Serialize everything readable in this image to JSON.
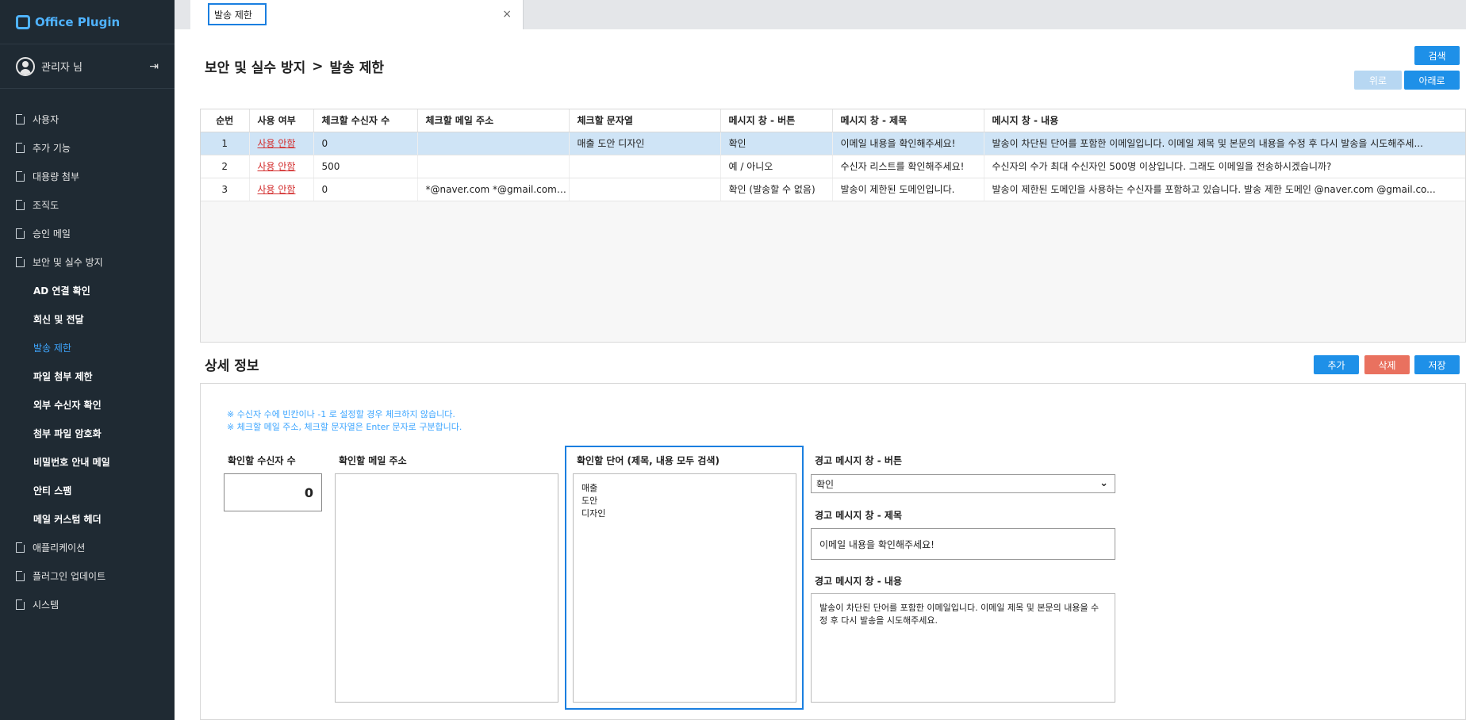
{
  "app": {
    "brand": "Office Plugin"
  },
  "user": {
    "name": "관리자 님"
  },
  "sidebar": {
    "items": [
      {
        "label": "사용자"
      },
      {
        "label": "추가 기능"
      },
      {
        "label": "대용량 첨부"
      },
      {
        "label": "조직도"
      },
      {
        "label": "승인 메일"
      },
      {
        "label": "보안 및 실수 방지"
      },
      {
        "label": "AD 연결 확인"
      },
      {
        "label": "회신 및 전달"
      },
      {
        "label": "발송 제한"
      },
      {
        "label": "파일 첨부 제한"
      },
      {
        "label": "외부 수신자 확인"
      },
      {
        "label": "첨부 파일 암호화"
      },
      {
        "label": "비밀번호 안내 메일"
      },
      {
        "label": "안티 스팸"
      },
      {
        "label": "메일 커스텀 헤더"
      },
      {
        "label": "애플리케이션"
      },
      {
        "label": "플러그인 업데이트"
      },
      {
        "label": "시스템"
      }
    ]
  },
  "tab": {
    "label": "발송 제한",
    "close": "×"
  },
  "breadcrumb": {
    "parent": "보안 및 실수 방지",
    "sep": ">",
    "current": "발송 제한"
  },
  "buttons": {
    "search": "검색",
    "up": "위로",
    "down": "아래로",
    "add": "추가",
    "delete": "삭제",
    "save": "저장"
  },
  "table": {
    "headers": [
      "순번",
      "사용 여부",
      "체크할 수신자 수",
      "체크할 메일 주소",
      "체크할 문자열",
      "메시지 창 - 버튼",
      "메시지 창 - 제목",
      "메시지 창 - 내용"
    ],
    "rows": [
      [
        "1",
        "사용 안함",
        "0",
        "",
        "매출 도안 디자인",
        "확인",
        "이메일 내용을 확인해주세요!",
        "발송이 차단된 단어를 포함한 이메일입니다. 이메일 제목 및 본문의 내용을 수정 후 다시 발송을 시도해주세..."
      ],
      [
        "2",
        "사용 안함",
        "500",
        "",
        "",
        "예 / 아니오",
        "수신자 리스트를 확인해주세요!",
        "수신자의 수가 최대 수신자인 500명 이상입니다. 그래도 이메일을 전송하시겠습니까?"
      ],
      [
        "3",
        "사용 안함",
        "0",
        "*@naver.com *@gmail.com *...",
        "",
        "확인 (발송할 수 없음)",
        "발송이 제한된 도메인입니다.",
        "발송이 제한된 도메인을 사용하는 수신자를 포함하고 있습니다. 발송 제한 도메인 @naver.com @gmail.co..."
      ]
    ]
  },
  "detail": {
    "title": "상세 정보",
    "note1": "※ 수신자 수에 빈칸이나 -1 로 설정할 경우 체크하지 않습니다.",
    "note2": "※ 체크할 메일 주소, 체크할 문자열은 Enter 문자로 구분합니다.",
    "recipients_label": "확인할 수신자 수",
    "recipients_value": "0",
    "emails_label": "확인할 메일 주소",
    "emails_value": "",
    "words_label": "확인할 단어 (제목, 내용 모두 검색)",
    "words_value": "매출\n도안\n디자인",
    "button_label": "경고 메시지 창 - 버튼",
    "button_value": "확인",
    "title_label": "경고 메시지 창 - 제목",
    "title_value": "이메일 내용을 확인해주세요!",
    "content_label": "경고 메시지 창 - 내용",
    "content_value": "발송이 차단된 단어를 포함한 이메일입니다. 이메일 제목 및 본문의 내용을 수정 후 다시 발송을 시도해주세요."
  },
  "icons": {
    "logo": "office-plugin-logo-icon",
    "avatar": "user-avatar-icon",
    "logout": "logout-icon",
    "doc": "document-icon",
    "chevron": "chevron-down-icon",
    "close": "close-icon"
  },
  "colors": {
    "sidebar_bg": "#1f2a33",
    "accent": "#1e90e8",
    "active": "#3ea6ff",
    "danger": "#e9715f",
    "selected_row": "#cfe4f6",
    "link_red": "#d32f2f"
  }
}
